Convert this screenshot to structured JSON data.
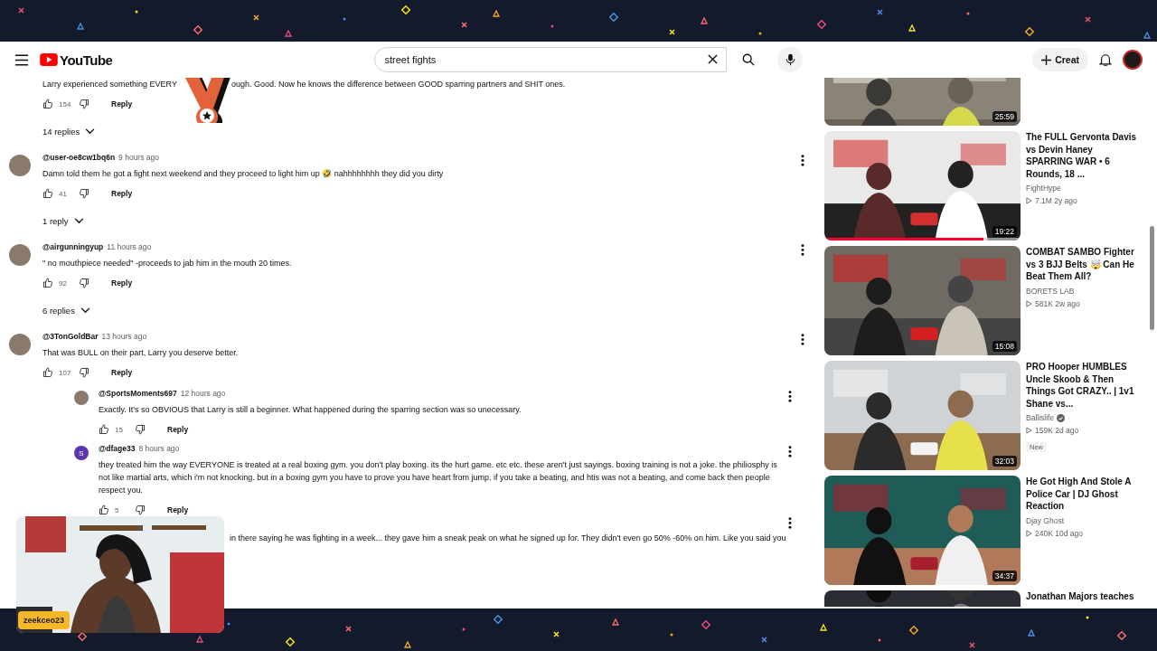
{
  "header": {
    "logo_text": "YouTube",
    "search": {
      "value": "street fights"
    },
    "create_label": "Creat"
  },
  "comments": [
    {
      "kind": "cut",
      "text_before": "Larry experienced something EVERY",
      "text_after": "ough. Good. Now he knows the difference between GOOD sparring partners and SHIT ones.",
      "likes": "154",
      "reply_label": "Reply",
      "replies_toggle": "14 replies"
    },
    {
      "kind": "full",
      "avatar": {
        "kind": "picture"
      },
      "author": "@user-oe8cw1bq6n",
      "time": "9 hours ago",
      "text": "Damn told them he got a fight next weekend and they proceed to light him up 🤣 nahhhhhhhh they did you dirty",
      "likes": "41",
      "reply_label": "Reply",
      "replies_toggle": "1 reply"
    },
    {
      "kind": "full",
      "avatar": {
        "kind": "picture"
      },
      "author": "@airgunningyup",
      "time": "11 hours ago",
      "text": "\" no mouthpiece needed\" -proceeds to jab him in the mouth 20 times.",
      "likes": "92",
      "reply_label": "Reply",
      "replies_toggle": "6 replies"
    },
    {
      "kind": "full",
      "avatar": {
        "kind": "picture"
      },
      "author": "@3TonGoldBar",
      "time": "13 hours ago",
      "text": "That was BULL on their part, Larry you deserve better.",
      "likes": "107",
      "reply_label": "Reply",
      "replies": [
        {
          "kind": "full",
          "avatar": {
            "kind": "picture"
          },
          "author": "@SportsMoments697",
          "time": "12 hours ago",
          "text": "Exactly. It's so OBVIOUS that Larry is still a beginner. What happened during the sparring section was so unecessary.",
          "likes": "15",
          "reply_label": "Reply"
        },
        {
          "kind": "full",
          "avatar": {
            "kind": "letter",
            "letter": "S",
            "color": "#5e35b1"
          },
          "author": "@dfage33",
          "time": "8 hours ago",
          "text": "they treated him the way EVERYONE is treated at a real boxing gym. you don't play boxing. its the hurt game. etc etc. these aren't just sayings. boxing training is not a joke. the philiosphy is not like martial arts, which i'm not knocking. but in a boxing gym you have to prove you have heart from jump. if you take a beating, and htis was not a beating, and come back then people respect you.",
          "likes": "5",
          "reply_label": "Reply"
        },
        {
          "kind": "hidden",
          "text": "in there saying he was fighting in a week... they gave him a sneak peak on what he signed up for. They didn't even go 50% -60% on him. Like you said you"
        }
      ]
    }
  ],
  "videos": [
    {
      "duration": "25:59"
    },
    {
      "title": "The FULL Gervonta Davis vs Devin Haney SPARRING WAR • 6 Rounds, 18 ...",
      "channel": "FightHype",
      "verified": false,
      "views": "7.1M",
      "age": "2y ago",
      "duration": "19:22",
      "level": 0.81
    },
    {
      "title": "COMBAT SAMBO Fighter vs 3 BJJ Belts 🤯 Can He Beat Them All?",
      "channel": "BORETS LAB",
      "verified": false,
      "views": "581K",
      "age": "2w ago",
      "duration": "15:08"
    },
    {
      "title": "PRO Hooper HUMBLES Uncle Skoob & Then Things Got CRAZY.. | 1v1 Shane vs...",
      "channel": "Ballislife",
      "verified": true,
      "views": "159K",
      "age": "2d ago",
      "badge": "New",
      "duration": "32:03"
    },
    {
      "title": "He Got High And Stole A Police Car | DJ Ghost Reaction",
      "channel": "Djay Ghost",
      "verified": false,
      "views": "240K",
      "age": "10d ago",
      "duration": "34:37"
    },
    {
      "title": "Jonathan Majors teaches"
    }
  ],
  "webcam": {
    "name": "zeekceo23"
  }
}
